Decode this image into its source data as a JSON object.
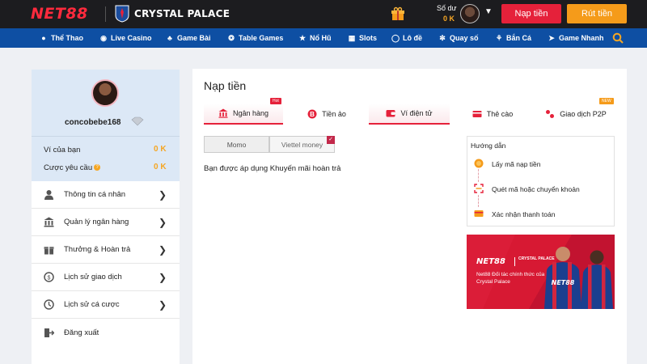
{
  "header": {
    "logo": "NET88",
    "club_name": "CRYSTAL PALACE",
    "balance_label": "Số dư",
    "balance_value": "0 K",
    "deposit_label": "Nạp tiền",
    "withdraw_label": "Rút tiền",
    "colors": {
      "bar": "#1c1c1f",
      "brand": "#ff2a3d",
      "deposit": "#e5213a",
      "withdraw": "#f59b1a"
    }
  },
  "nav": {
    "items": [
      {
        "label": "Thể Thao",
        "icon": "sports-icon"
      },
      {
        "label": "Live Casino",
        "icon": "live-casino-icon"
      },
      {
        "label": "Game Bài",
        "icon": "cards-icon"
      },
      {
        "label": "Table Games",
        "icon": "table-games-icon"
      },
      {
        "label": "Nổ Hũ",
        "icon": "jackpot-icon"
      },
      {
        "label": "Slots",
        "icon": "slots-icon"
      },
      {
        "label": "Lô đề",
        "icon": "lottery-icon"
      },
      {
        "label": "Quay số",
        "icon": "number-draw-icon"
      },
      {
        "label": "Bắn Cá",
        "icon": "fishing-icon"
      },
      {
        "label": "Game Nhanh",
        "icon": "rocket-icon"
      }
    ],
    "color": "#0e4fa3"
  },
  "sidebar": {
    "username": "concobebe168",
    "wallet_label": "Ví của bạn",
    "wallet_value": "0 K",
    "required_bet_label": "Cược yêu cầu",
    "required_bet_value": "0 K",
    "menu": [
      {
        "label": "Thông tin cá nhân",
        "icon": "user-icon"
      },
      {
        "label": "Quản lý ngân hàng",
        "icon": "bank-icon"
      },
      {
        "label": "Thưởng & Hoàn trả",
        "icon": "gift-icon"
      },
      {
        "label": "Lịch sử giao dịch",
        "icon": "transaction-history-icon"
      },
      {
        "label": "Lịch sử cá cược",
        "icon": "bet-history-icon"
      },
      {
        "label": "Đăng xuất",
        "icon": "logout-icon"
      }
    ]
  },
  "main": {
    "title": "Nạp tiền",
    "tabs": [
      {
        "label": "Ngân hàng",
        "icon": "bank-icon",
        "badge": "Hot"
      },
      {
        "label": "Tiền ảo",
        "icon": "bitcoin-icon"
      },
      {
        "label": "Ví điện tử",
        "icon": "wallet-icon"
      },
      {
        "label": "Thẻ cào",
        "icon": "card-icon"
      },
      {
        "label": "Giao dịch P2P",
        "icon": "p2p-icon",
        "badge": "NEW"
      }
    ],
    "active_tab": "Ví điện tử",
    "sub_tabs": [
      {
        "label": "Momo"
      },
      {
        "label": "Viettel money"
      }
    ],
    "selected_sub_tab": "Viettel money",
    "promo_text": "Bạn được áp dụng Khuyến mãi hoàn trả"
  },
  "guide": {
    "title": "Hướng dẫn",
    "steps": [
      {
        "label": "Lấy mã nạp tiền",
        "icon": "coin-icon"
      },
      {
        "label": "Quét mã hoặc chuyển khoản",
        "icon": "scan-icon"
      },
      {
        "label": "Xác nhận thanh toán",
        "icon": "card-confirm-icon"
      }
    ]
  },
  "banner": {
    "logo": "NET88",
    "club": "CRYSTAL PALACE",
    "text": "Net88 Đối tác chính thức của Crystal Palace"
  }
}
